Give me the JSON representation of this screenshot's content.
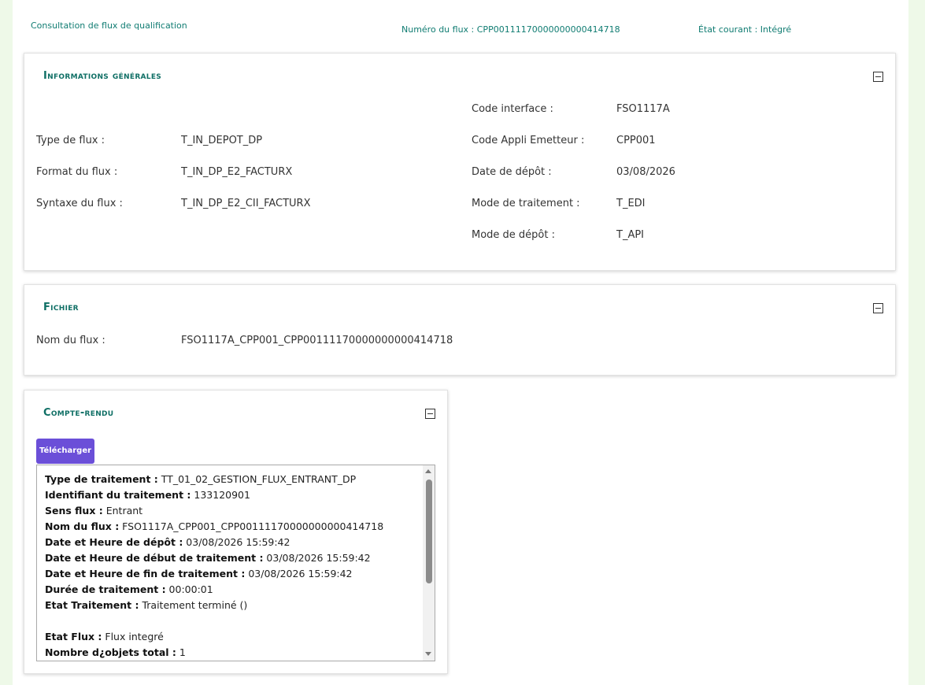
{
  "header": {
    "page_title": "Consultation de flux de qualification",
    "flux_number": "Numéro du flux : CPP00111170000000000414718",
    "current_state": "État courant : Intégré"
  },
  "general": {
    "title": "Informations générales",
    "left": [
      {
        "label": "Type de flux :",
        "value": "T_IN_DEPOT_DP"
      },
      {
        "label": "Format du flux :",
        "value": "T_IN_DP_E2_FACTURX"
      },
      {
        "label": "Syntaxe du flux :",
        "value": "T_IN_DP_E2_CII_FACTURX"
      }
    ],
    "right": [
      {
        "label": "Code interface :",
        "value": "FSO1117A"
      },
      {
        "label": "Code Appli Emetteur :",
        "value": "CPP001"
      },
      {
        "label": "Date de dépôt :",
        "value": "03/08/2026"
      },
      {
        "label": "Mode de traitement :",
        "value": "T_EDI"
      },
      {
        "label": "Mode de dépôt :",
        "value": "T_API"
      }
    ]
  },
  "fichier": {
    "title": "Fichier",
    "label": "Nom du flux :",
    "value": "FSO1117A_CPP001_CPP00111170000000000414718"
  },
  "compte_rendu": {
    "title": "Compte-rendu",
    "download_label": "Télécharger",
    "lines": [
      {
        "label": "Type de traitement :",
        "value": " TT_01_02_GESTION_FLUX_ENTRANT_DP"
      },
      {
        "label": "Identifiant du traitement :",
        "value": " 133120901"
      },
      {
        "label": "Sens flux :",
        "value": " Entrant"
      },
      {
        "label": "Nom du flux :",
        "value": " FSO1117A_CPP001_CPP00111170000000000414718"
      },
      {
        "label": "Date et Heure de dépôt :",
        "value": " 03/08/2026 15:59:42"
      },
      {
        "label": "Date et Heure de début de traitement :",
        "value": " 03/08/2026 15:59:42"
      },
      {
        "label": "Date et Heure de fin de traitement :",
        "value": " 03/08/2026 15:59:42"
      },
      {
        "label": "Durée de traitement :",
        "value": " 00:00:01"
      },
      {
        "label": "Etat Traitement :",
        "value": " Traitement terminé ()"
      },
      {
        "label": "",
        "value": ""
      },
      {
        "label": "Etat Flux :",
        "value": " Flux integré"
      },
      {
        "label": "Nombre d¿objets total :",
        "value": " 1"
      }
    ]
  }
}
